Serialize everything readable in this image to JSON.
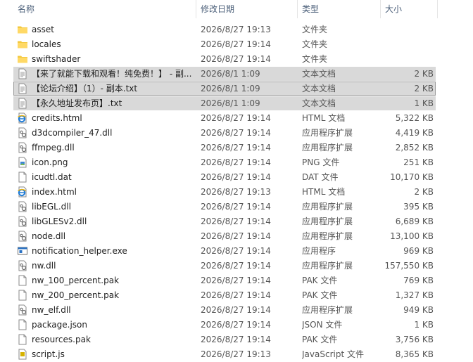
{
  "columns": {
    "name": "名称",
    "date": "修改日期",
    "type": "类型",
    "size": "大小"
  },
  "sort_indicator": "^",
  "files": [
    {
      "name": "asset",
      "date": "2026/8/27 19:13",
      "type": "文件夹",
      "size": "",
      "icon": "folder-icon",
      "selected": false
    },
    {
      "name": "locales",
      "date": "2026/8/27 19:14",
      "type": "文件夹",
      "size": "",
      "icon": "folder-icon",
      "selected": false
    },
    {
      "name": "swiftshader",
      "date": "2026/8/27 19:14",
      "type": "文件夹",
      "size": "",
      "icon": "folder-icon",
      "selected": false
    },
    {
      "name": "【来了就能下载和观看！纯免费！】 - 副...",
      "date": "2026/8/1 1:09",
      "type": "文本文档",
      "size": "2 KB",
      "icon": "text-file-icon",
      "selected": true
    },
    {
      "name": "【论坛介绍】（1）- 副本.txt",
      "date": "2026/8/1 1:09",
      "type": "文本文档",
      "size": "2 KB",
      "icon": "text-file-icon",
      "selected": true,
      "focus": true
    },
    {
      "name": "【永久地址发布页】.txt",
      "date": "2026/8/1 1:09",
      "type": "文本文档",
      "size": "1 KB",
      "icon": "text-file-icon",
      "selected": true
    },
    {
      "name": "credits.html",
      "date": "2026/8/27 19:14",
      "type": "HTML 文档",
      "size": "5,322 KB",
      "icon": "html-file-icon",
      "selected": false
    },
    {
      "name": "d3dcompiler_47.dll",
      "date": "2026/8/27 19:14",
      "type": "应用程序扩展",
      "size": "4,419 KB",
      "icon": "dll-file-icon",
      "selected": false
    },
    {
      "name": "ffmpeg.dll",
      "date": "2026/8/27 19:14",
      "type": "应用程序扩展",
      "size": "2,852 KB",
      "icon": "dll-file-icon",
      "selected": false
    },
    {
      "name": "icon.png",
      "date": "2026/8/27 19:14",
      "type": "PNG 文件",
      "size": "251 KB",
      "icon": "png-file-icon",
      "selected": false
    },
    {
      "name": "icudtl.dat",
      "date": "2026/8/27 19:14",
      "type": "DAT 文件",
      "size": "10,170 KB",
      "icon": "generic-file-icon",
      "selected": false
    },
    {
      "name": "index.html",
      "date": "2026/8/27 19:13",
      "type": "HTML 文档",
      "size": "2 KB",
      "icon": "html-file-icon",
      "selected": false
    },
    {
      "name": "libEGL.dll",
      "date": "2026/8/27 19:14",
      "type": "应用程序扩展",
      "size": "395 KB",
      "icon": "dll-file-icon",
      "selected": false
    },
    {
      "name": "libGLESv2.dll",
      "date": "2026/8/27 19:14",
      "type": "应用程序扩展",
      "size": "6,689 KB",
      "icon": "dll-file-icon",
      "selected": false
    },
    {
      "name": "node.dll",
      "date": "2026/8/27 19:14",
      "type": "应用程序扩展",
      "size": "13,100 KB",
      "icon": "dll-file-icon",
      "selected": false
    },
    {
      "name": "notification_helper.exe",
      "date": "2026/8/27 19:14",
      "type": "应用程序",
      "size": "969 KB",
      "icon": "exe-file-icon",
      "selected": false
    },
    {
      "name": "nw.dll",
      "date": "2026/8/27 19:14",
      "type": "应用程序扩展",
      "size": "157,550 KB",
      "icon": "dll-file-icon",
      "selected": false
    },
    {
      "name": "nw_100_percent.pak",
      "date": "2026/8/27 19:14",
      "type": "PAK 文件",
      "size": "769 KB",
      "icon": "generic-file-icon",
      "selected": false
    },
    {
      "name": "nw_200_percent.pak",
      "date": "2026/8/27 19:14",
      "type": "PAK 文件",
      "size": "1,327 KB",
      "icon": "generic-file-icon",
      "selected": false
    },
    {
      "name": "nw_elf.dll",
      "date": "2026/8/27 19:14",
      "type": "应用程序扩展",
      "size": "949 KB",
      "icon": "dll-file-icon",
      "selected": false
    },
    {
      "name": "package.json",
      "date": "2026/8/27 19:14",
      "type": "JSON 文件",
      "size": "1 KB",
      "icon": "generic-file-icon",
      "selected": false
    },
    {
      "name": "resources.pak",
      "date": "2026/8/27 19:14",
      "type": "PAK 文件",
      "size": "3,756 KB",
      "icon": "generic-file-icon",
      "selected": false
    },
    {
      "name": "script.js",
      "date": "2026/8/27 19:13",
      "type": "JavaScript 文件",
      "size": "8,365 KB",
      "icon": "js-file-icon",
      "selected": false
    }
  ]
}
